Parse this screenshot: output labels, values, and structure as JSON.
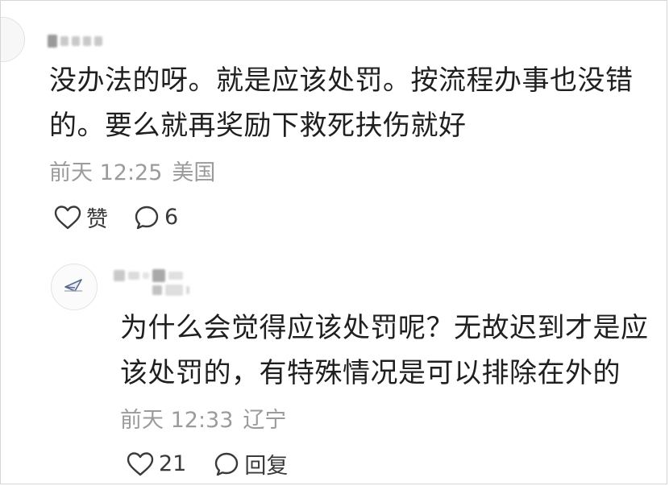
{
  "comment": {
    "lines": [
      "没办法的呀。就是应该处罚。按流程办事也没错",
      "的。要么就再奖励下救死扶伤就好"
    ],
    "time": "前天 12:25",
    "location": "美国",
    "like_label": "赞",
    "reply_count": "6"
  },
  "reply": {
    "lines": [
      "为什么会觉得应该处罚呢？无故迟到才是应",
      "该处罚的，有特殊情况是可以排除在外的"
    ],
    "time": "前天 12:33",
    "location": "辽宁",
    "like_count": "21",
    "reply_label": "回复"
  },
  "icons": {
    "like": "heart-outline-icon",
    "comment": "speech-bubble-outline-icon",
    "avatar": "paper-plane-avatar-icon"
  },
  "colors": {
    "text": "#1f1f1f",
    "meta": "#9b9b9b",
    "action": "#3a3a3a"
  }
}
